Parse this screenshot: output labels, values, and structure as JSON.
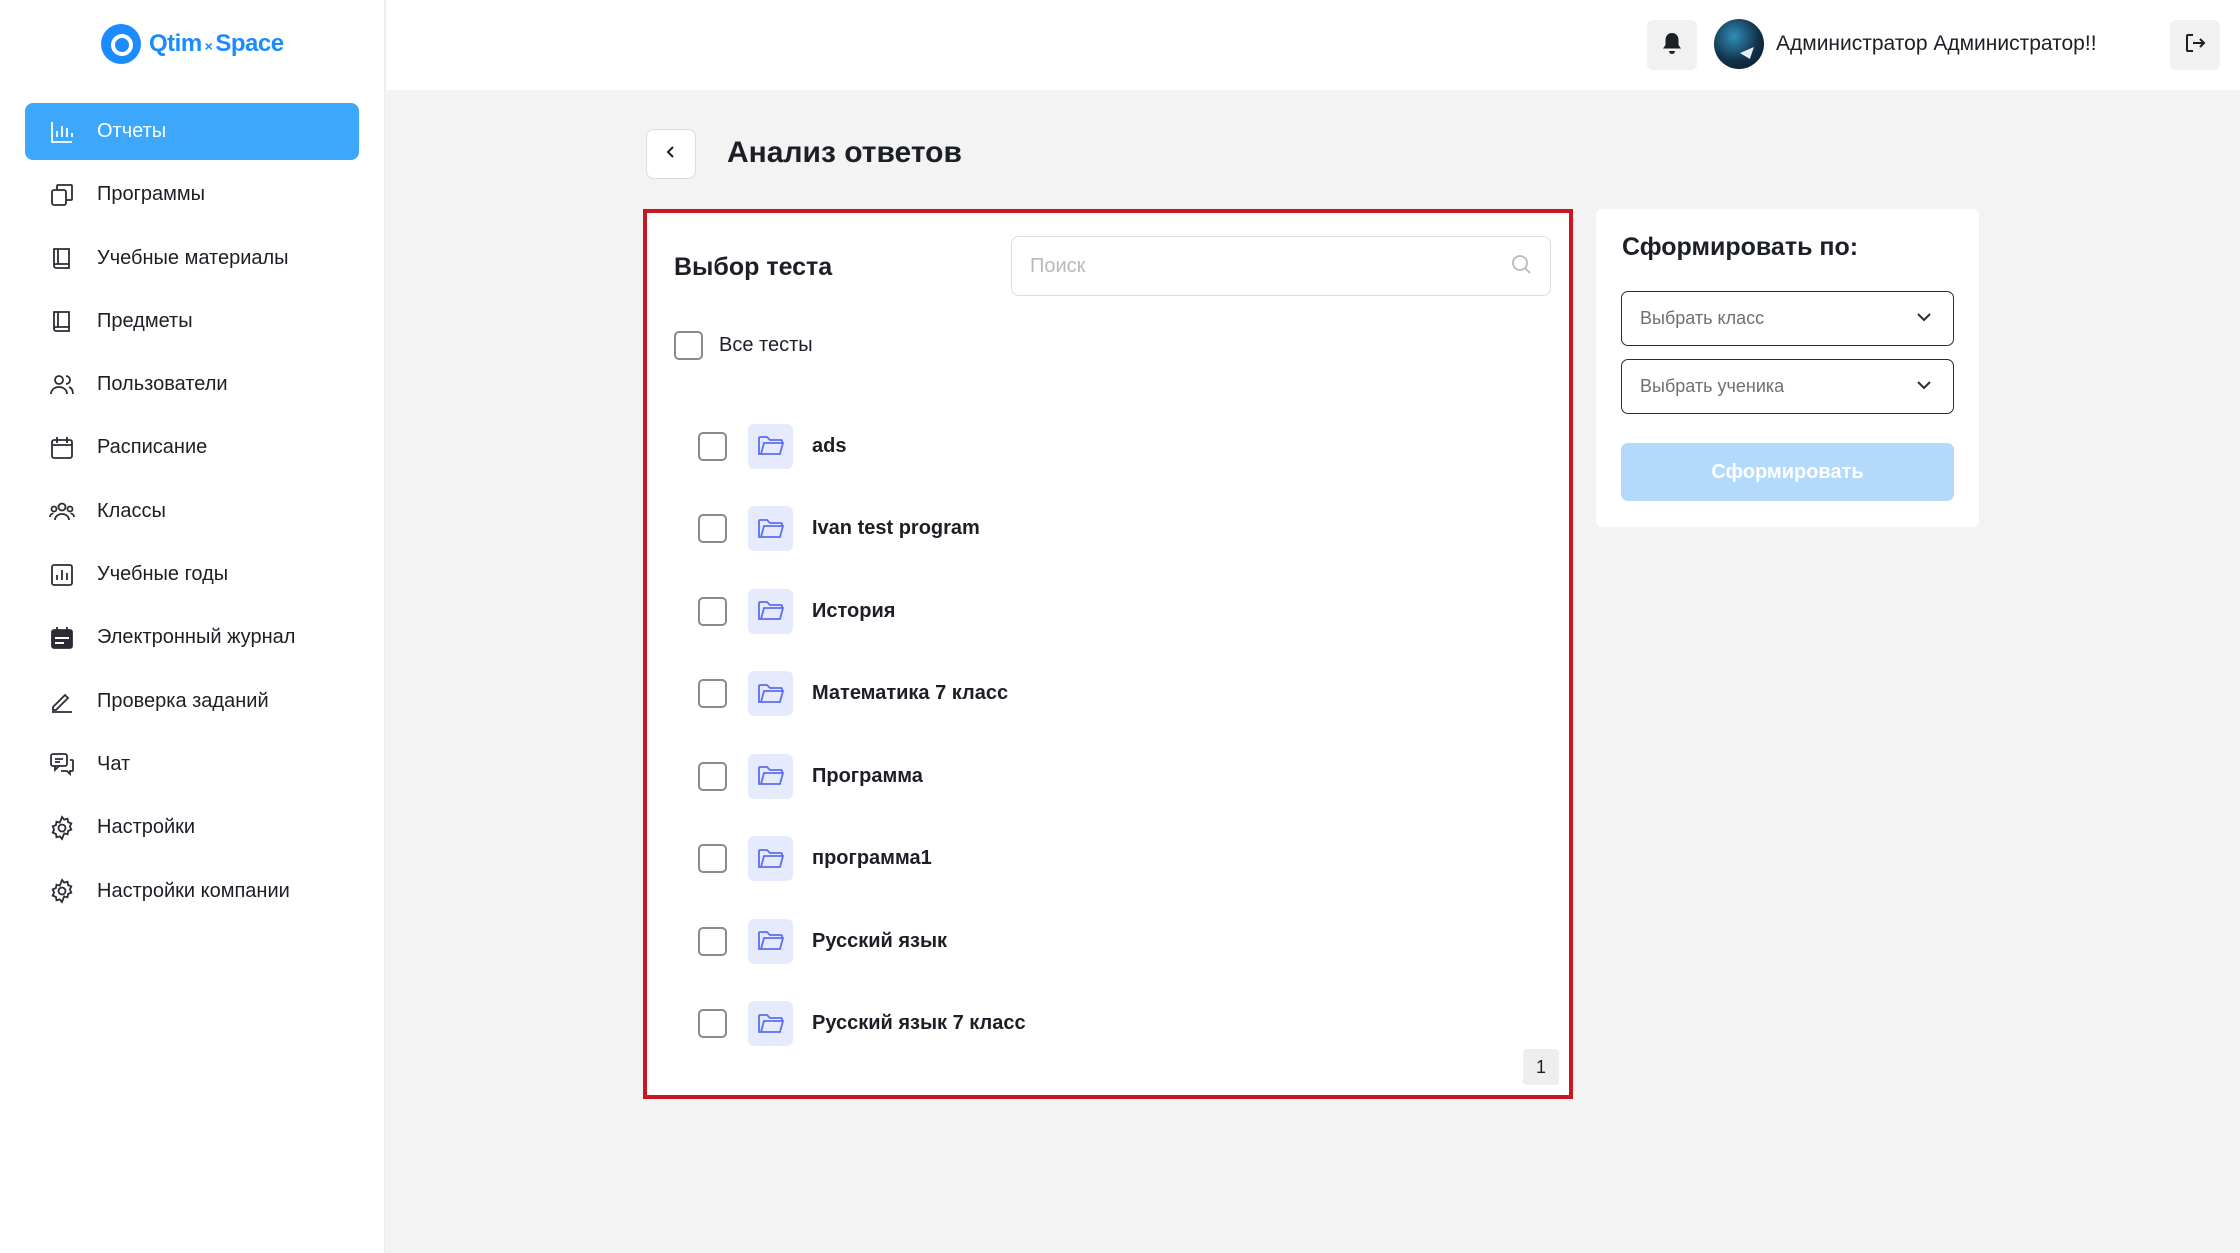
{
  "app": {
    "logo_main": "Qtim",
    "logo_x": "×",
    "logo_tail": "Space"
  },
  "sidebar": {
    "items": [
      {
        "label": "Отчеты",
        "icon": "chart-icon",
        "active": true
      },
      {
        "label": "Программы",
        "icon": "copy-icon"
      },
      {
        "label": "Учебные материалы",
        "icon": "book-icon"
      },
      {
        "label": "Предметы",
        "icon": "book-icon"
      },
      {
        "label": "Пользователи",
        "icon": "users-icon"
      },
      {
        "label": "Расписание",
        "icon": "calendar-icon"
      },
      {
        "label": "Классы",
        "icon": "group-icon"
      },
      {
        "label": "Учебные годы",
        "icon": "bar-chart-box-icon"
      },
      {
        "label": "Электронный журнал",
        "icon": "journal-icon"
      },
      {
        "label": "Проверка заданий",
        "icon": "pen-icon"
      },
      {
        "label": "Чат",
        "icon": "chat-icon"
      },
      {
        "label": "Настройки",
        "icon": "gear-icon"
      },
      {
        "label": "Настройки компании",
        "icon": "gear-icon"
      }
    ]
  },
  "header": {
    "user_name": "Администратор Администратор!!"
  },
  "main": {
    "title": "Анализ ответов",
    "test_panel": {
      "title": "Выбор теста",
      "search_placeholder": "Поиск",
      "all_label": "Все тесты",
      "items": [
        "ads",
        "Ivan test program",
        "История",
        "Математика 7 класс",
        "Программа",
        "программа1",
        "Русский язык",
        "Русский язык 7 класс"
      ],
      "page": "1"
    },
    "form": {
      "title": "Сформировать по:",
      "class_select": "Выбрать класс",
      "student_select": "Выбрать ученика",
      "submit": "Сформировать"
    }
  },
  "colors": {
    "accent": "#3da8fb",
    "highlight_border": "#c8171e",
    "button_disabled": "#b3dafb",
    "folder_bg": "#e5ebfd"
  }
}
